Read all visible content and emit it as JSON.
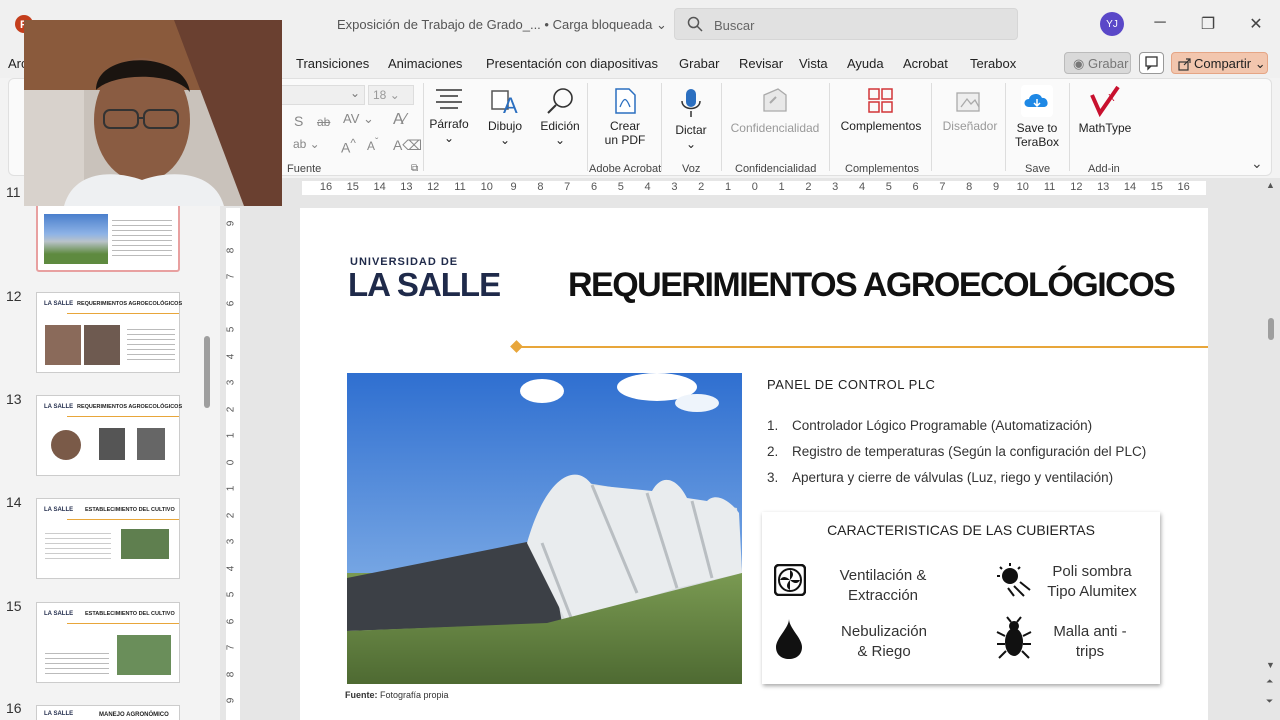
{
  "window": {
    "doc_title": "Exposición de Trabajo de Grado_...",
    "status": "Carga bloqueada",
    "search_placeholder": "Buscar",
    "user_initials": "YJ"
  },
  "tabs": [
    "Transiciones",
    "Animaciones",
    "Presentación con diapositivas",
    "Grabar",
    "Revisar",
    "Vista",
    "Ayuda",
    "Acrobat",
    "Terabox"
  ],
  "tab_partial": "Arc",
  "actions": {
    "record": "Grabar",
    "share": "Compartir"
  },
  "ribbon": {
    "font_size": "18",
    "groups": {
      "fuente": "Fuente",
      "adobe": "Adobe Acrobat",
      "voz": "Voz",
      "conf": "Confidencialidad",
      "comp": "Complementos",
      "save": "Save",
      "addin": "Add-in"
    },
    "buttons": {
      "parrafo": "Párrafo",
      "dibujo": "Dibujo",
      "edicion": "Edición",
      "crear_pdf_1": "Crear",
      "crear_pdf_2": "un PDF",
      "dictar": "Dictar",
      "confidencialidad": "Confidencialidad",
      "complementos": "Complementos",
      "disenador": "Diseñador",
      "save1": "Save to",
      "save2": "TeraBox",
      "mathtype": "MathType"
    }
  },
  "slides": {
    "numbers": [
      "11",
      "12",
      "13",
      "14",
      "15",
      "16"
    ],
    "thumb_titles": [
      "REQUERIMIENTOS AGROECOLÓGICOS",
      "REQUERIMIENTOS AGROECOLÓGICOS",
      "ESTABLECIMIENTO DEL CULTIVO",
      "ESTABLECIMIENTO DEL CULTIVO",
      "MANEJO AGRONÓMICO"
    ],
    "thumb_brand": "LA SALLE"
  },
  "ruler": {
    "h_ticks": [
      "16",
      "15",
      "14",
      "13",
      "12",
      "11",
      "10",
      "9",
      "8",
      "7",
      "6",
      "5",
      "4",
      "3",
      "2",
      "1",
      "0",
      "1",
      "2",
      "3",
      "4",
      "5",
      "6",
      "7",
      "8",
      "9",
      "10",
      "11",
      "12",
      "13",
      "14",
      "15",
      "16"
    ],
    "v_ticks": [
      "9",
      "8",
      "7",
      "6",
      "5",
      "4",
      "3",
      "2",
      "1",
      "0",
      "1",
      "2",
      "3",
      "4",
      "5",
      "6",
      "7",
      "8",
      "9"
    ]
  },
  "slide": {
    "brand_top": "UNIVERSIDAD DE",
    "brand_main": "LA SALLE",
    "title": "REQUERIMIENTOS AGROECOLÓGICOS",
    "source_label": "Fuente:",
    "source_value": "Fotografía propia",
    "panel_title": "PANEL DE CONTROL PLC",
    "list": [
      {
        "n": "1.",
        "text": "Controlador Lógico Programable (Automatización)"
      },
      {
        "n": "2.",
        "text": "Registro de temperaturas (Según la configuración del PLC)"
      },
      {
        "n": "3.",
        "text": "Apertura y cierre de válvulas (Luz, riego y ventilación)"
      }
    ],
    "card_title": "CARACTERISTICAS DE LAS CUBIERTAS",
    "features": {
      "f1a": "Ventilación &",
      "f1b": "Extracción",
      "f2a": "Poli sombra",
      "f2b": "Tipo Alumitex",
      "f3a": "Nebulización",
      "f3b": "& Riego",
      "f4a": "Malla anti -",
      "f4b": "trips"
    }
  }
}
